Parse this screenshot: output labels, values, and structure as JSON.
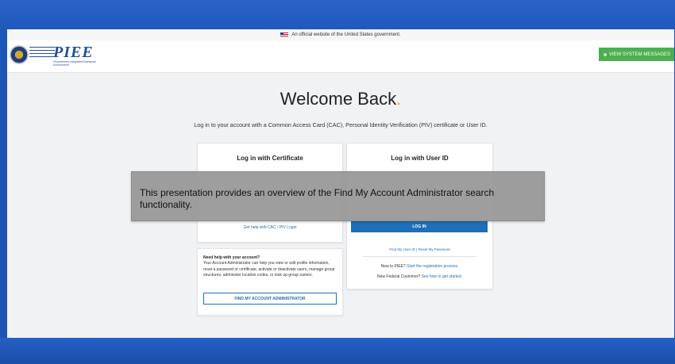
{
  "gov_banner": {
    "text": "An official website of the United States government."
  },
  "header": {
    "logo_text": "PIEE",
    "logo_subtext": "Procurement Integrated Enterprise Environment",
    "system_messages_button": "VIEW SYSTEM MESSAGES"
  },
  "main": {
    "title": "Welcome Back",
    "title_dot": ".",
    "subtitle": "Log in to your account with a Common Access Card (CAC), Personal Identity Verification (PIV) certificate or User ID."
  },
  "cert_card": {
    "title": "Log in with Certificate",
    "help_link": "Get help with CAC / PIV Login"
  },
  "userid_card": {
    "title": "Log in with User ID",
    "login_button": "LOG IN",
    "find_user_id": "Find My User ID",
    "separator": " | ",
    "reset_password": "Reset My Password",
    "new_text": "New to PIEE?",
    "registration_link": "Start the registration process.",
    "federal_text": "New Federal Customer?",
    "federal_link": "See how to get started."
  },
  "help_card": {
    "title": "Need help with your account?",
    "body": "Your Account Administrator can help you view or edit profile information, reset a password or certificate, activate or deactivate users, manage group structures, administer location codes, or look up group names.",
    "button": "FIND MY ACCOUNT ADMINISTRATOR"
  },
  "overlay": {
    "text": "This presentation provides an overview of the Find My Account Administrator search functionality."
  },
  "colors": {
    "accent": "#1e6fb8",
    "title_dot": "#f4a81d",
    "system_button": "#4caf50",
    "slide_background": "#1e56b8"
  }
}
